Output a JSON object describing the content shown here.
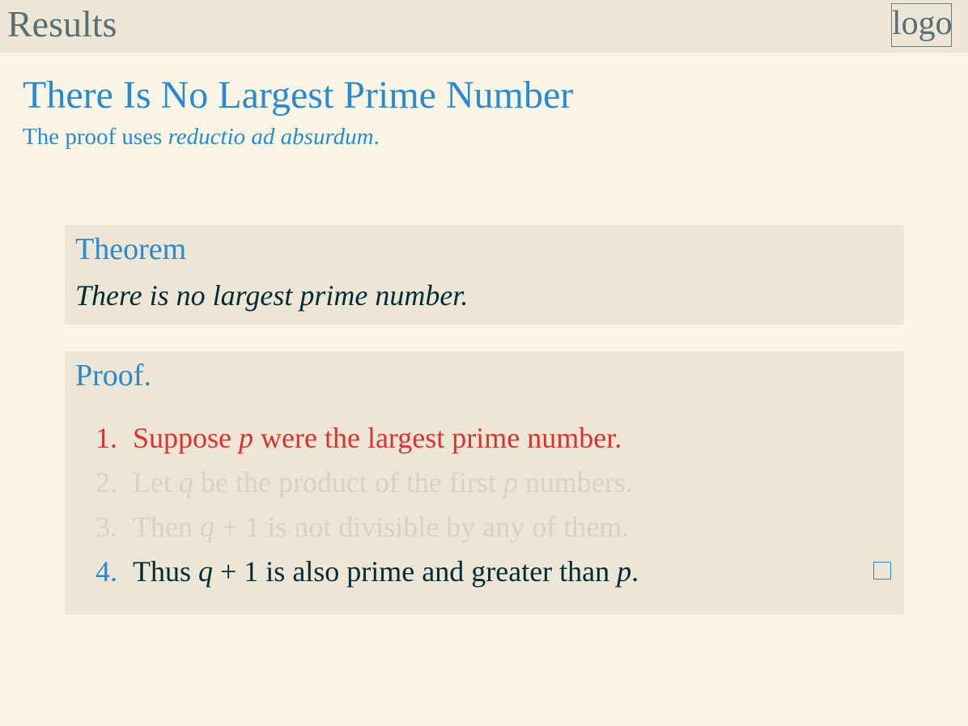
{
  "header": {
    "title": "Results",
    "logo_text": "logo"
  },
  "frame": {
    "title": "There Is No Largest Prime Number",
    "subtitle_prefix": "The proof uses ",
    "subtitle_emph": "reductio ad absurdum",
    "subtitle_suffix": "."
  },
  "theorem": {
    "title": "Theorem",
    "body": "There is no largest prime number."
  },
  "proof": {
    "title": "Proof.",
    "steps": [
      {
        "num": "1.",
        "a": "Suppose ",
        "v1": "p",
        "b": " were the largest prime number.",
        "v2": "",
        "c": ""
      },
      {
        "num": "2.",
        "a": "Let ",
        "v1": "q",
        "b": " be the product of the first ",
        "v2": "p",
        "c": " numbers."
      },
      {
        "num": "3.",
        "a": "Then ",
        "v1": "q",
        "b": " + 1 is not divisible by any of them.",
        "v2": "",
        "c": ""
      },
      {
        "num": "4.",
        "a": "Thus ",
        "v1": "q",
        "b": " + 1 is also prime and greater than ",
        "v2": "p",
        "c": "."
      }
    ],
    "qed_symbol": "qed-square-icon"
  },
  "colors": {
    "background": "#fcf5e3",
    "header_bg": "#ede6d4",
    "accent": "#268bd2",
    "alert": "#dc322f",
    "text": "#002b36",
    "faded": "#d5d2c6"
  }
}
